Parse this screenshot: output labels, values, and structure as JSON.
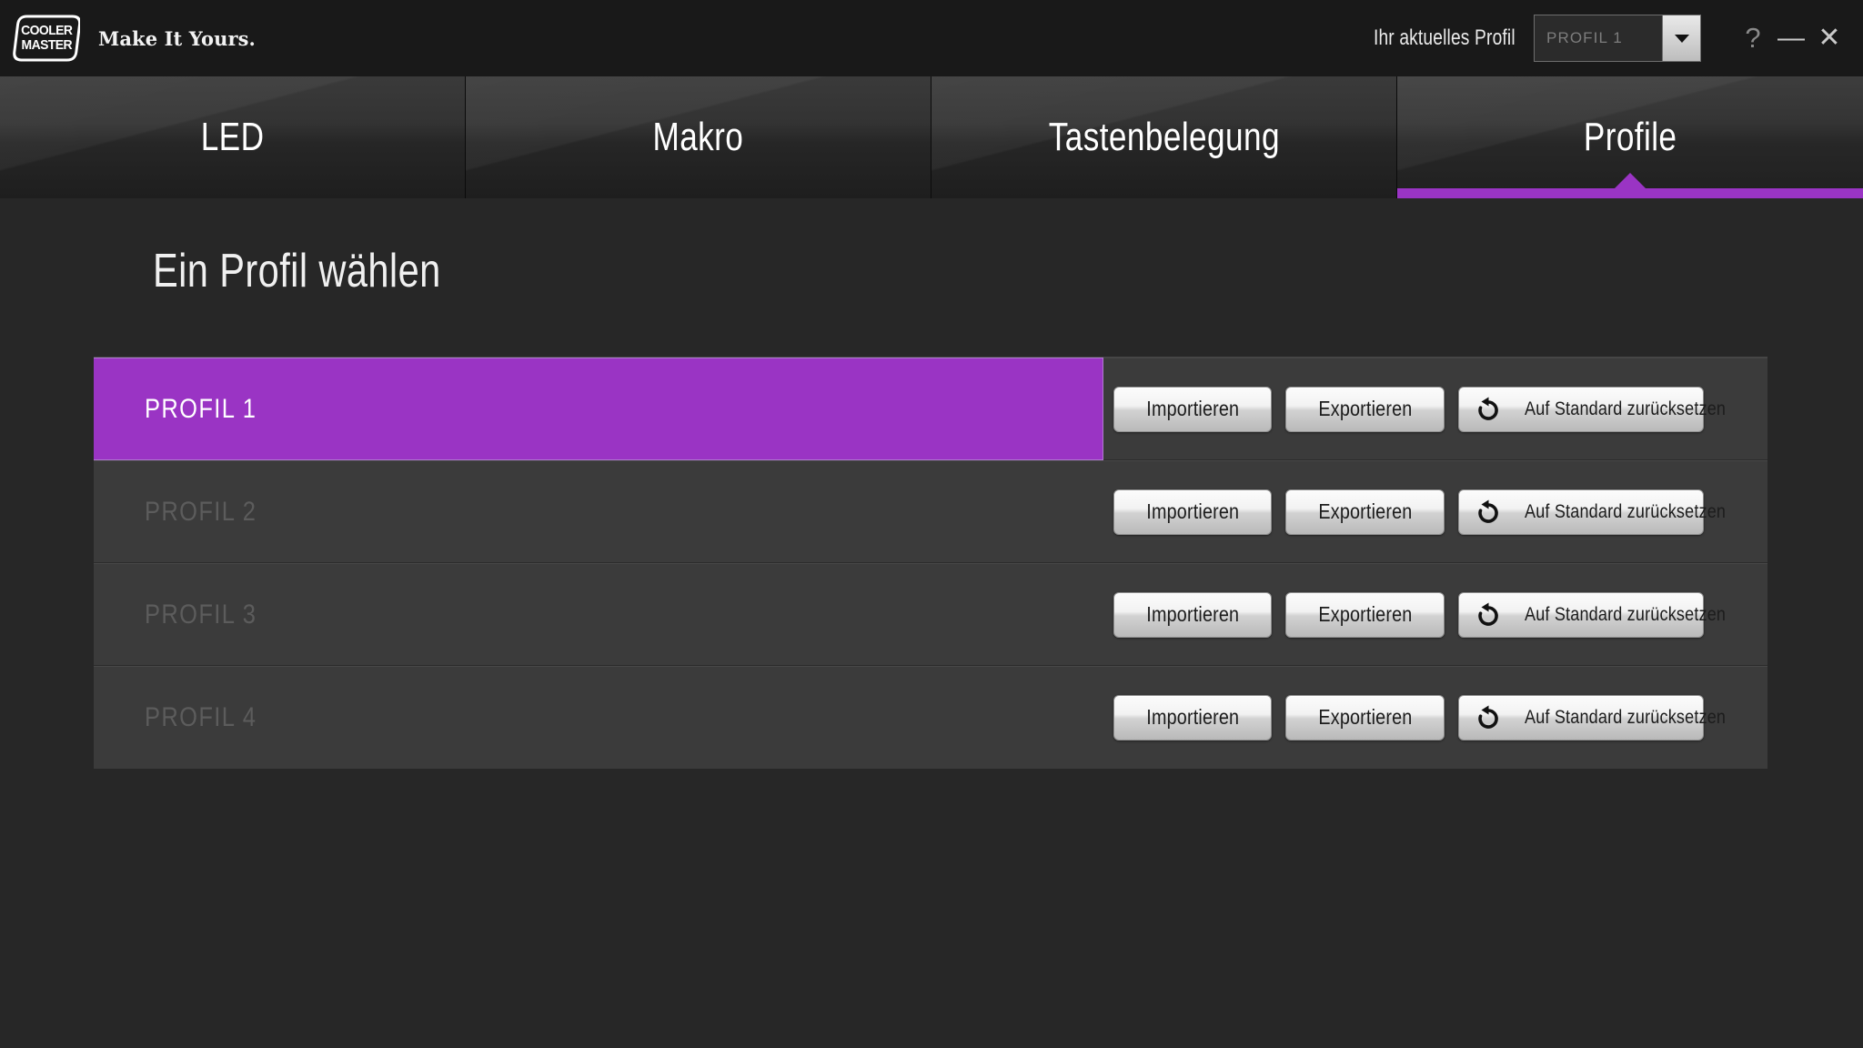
{
  "app": {
    "brand_line1": "COOLER",
    "brand_line2": "MASTER",
    "tagline": "Make It Yours.",
    "accent_color": "#9a34c4"
  },
  "header": {
    "current_profile_label": "Ihr aktuelles Profil",
    "profile_select_value": "PROFIL 1",
    "window_controls": {
      "help": "?",
      "minimize": "—",
      "close": "✕"
    }
  },
  "tabs": [
    {
      "id": "led",
      "label": "LED",
      "active": false
    },
    {
      "id": "makro",
      "label": "Makro",
      "active": false
    },
    {
      "id": "tastenbelegung",
      "label": "Tastenbelegung",
      "active": false
    },
    {
      "id": "profile",
      "label": "Profile",
      "active": true
    }
  ],
  "main": {
    "page_title": "Ein Profil wählen",
    "button_labels": {
      "import": "Importieren",
      "export": "Exportieren",
      "reset": "Auf Standard zurücksetzen"
    },
    "reset_icon": "undo-arrow-icon",
    "profiles": [
      {
        "name": "PROFIL 1",
        "selected": true
      },
      {
        "name": "PROFIL 2",
        "selected": false
      },
      {
        "name": "PROFIL 3",
        "selected": false
      },
      {
        "name": "PROFIL 4",
        "selected": false
      }
    ]
  }
}
